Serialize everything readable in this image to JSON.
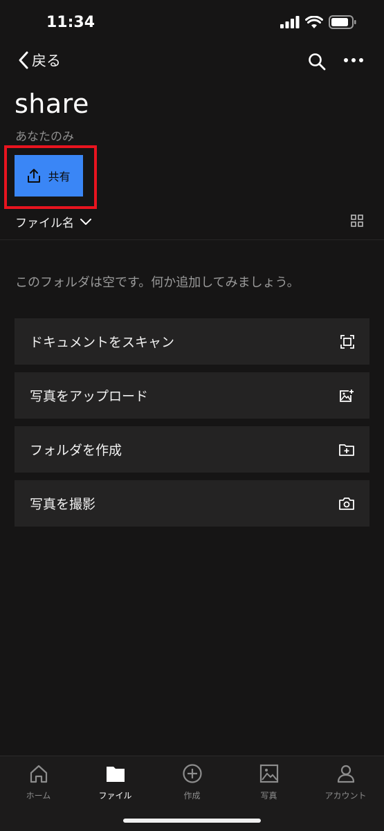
{
  "status_bar": {
    "time": "11:34"
  },
  "nav": {
    "back_label": "戻る",
    "search_icon": "search-icon",
    "more_icon": "more-icon"
  },
  "folder": {
    "title": "share",
    "subtitle": "あなたのみ"
  },
  "share_button": {
    "label": "共有",
    "icon": "share-upload-icon",
    "bg_color": "#3a86f6",
    "highlight_color": "#e8141f"
  },
  "sort": {
    "label": "ファイル名"
  },
  "empty_message": "このフォルダは空です。何か追加してみましょう。",
  "actions": [
    {
      "label": "ドキュメントをスキャン",
      "icon": "scan-icon"
    },
    {
      "label": "写真をアップロード",
      "icon": "image-upload-icon"
    },
    {
      "label": "フォルダを作成",
      "icon": "folder-add-icon"
    },
    {
      "label": "写真を撮影",
      "icon": "camera-icon"
    }
  ],
  "tabs": [
    {
      "label": "ホーム",
      "icon": "home-icon",
      "active": false
    },
    {
      "label": "ファイル",
      "icon": "folder-icon",
      "active": true
    },
    {
      "label": "作成",
      "icon": "plus-circle-icon",
      "active": false
    },
    {
      "label": "写真",
      "icon": "photo-icon",
      "active": false
    },
    {
      "label": "アカウント",
      "icon": "account-icon",
      "active": false
    }
  ]
}
